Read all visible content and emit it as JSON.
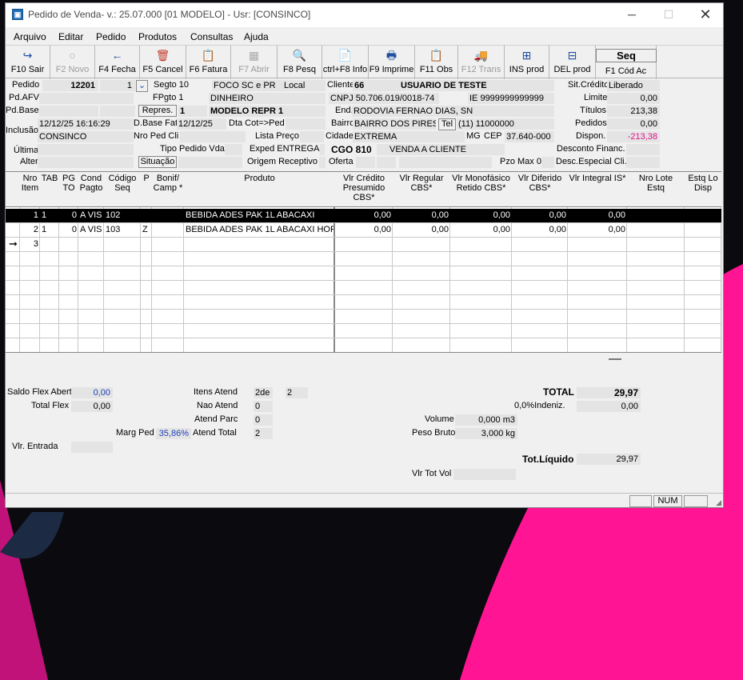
{
  "window": {
    "title": "Pedido de Venda- v.: 25.07.000  [01 MODELO] - Usr: [CONSINCO]"
  },
  "menu": [
    "Arquivo",
    "Editar",
    "Pedido",
    "Produtos",
    "Consultas",
    "Ajuda"
  ],
  "toolbar": [
    {
      "label": "F10 Sair",
      "icon": "exit-icon",
      "glyph": "↪",
      "enabled": true
    },
    {
      "label": "F2 Novo",
      "icon": "lightbulb-icon",
      "glyph": "○",
      "enabled": false
    },
    {
      "label": "F4 Fecha",
      "icon": "arrow-left-icon",
      "glyph": "←",
      "enabled": true
    },
    {
      "label": "F5 Cancel",
      "icon": "trash-icon",
      "glyph": "🗑",
      "enabled": true
    },
    {
      "label": "F6 Fatura",
      "icon": "clipboard-icon",
      "glyph": "📋",
      "enabled": true
    },
    {
      "label": "F7 Abrir",
      "icon": "table-icon",
      "glyph": "▦",
      "enabled": false
    },
    {
      "label": "F8 Pesq",
      "icon": "search-icon",
      "glyph": "🔍",
      "enabled": true
    },
    {
      "label": "ctrl+F8 Info",
      "icon": "document-icon",
      "glyph": "📄",
      "enabled": true
    },
    {
      "label": "F9 Imprime",
      "icon": "printer-icon",
      "glyph": "🖶",
      "enabled": true
    },
    {
      "label": "F11 Obs",
      "icon": "notes-icon",
      "glyph": "📋",
      "enabled": true
    },
    {
      "label": "F12 Trans",
      "icon": "truck-icon",
      "glyph": "🚚",
      "enabled": false
    },
    {
      "label": "INS prod",
      "icon": "add-row-icon",
      "glyph": "⊞",
      "enabled": true
    },
    {
      "label": "DEL prod",
      "icon": "remove-row-icon",
      "glyph": "⊟",
      "enabled": true
    },
    {
      "label": "F1 Cód Ac",
      "icon": "",
      "glyph": "",
      "enabled": true
    }
  ],
  "seq_label": "Seq",
  "header": {
    "pedido_label": "Pedido",
    "pedido": "12201",
    "pedido_seq": "1",
    "segto_label": "Segto 10",
    "segto": "FOCO SC e PR",
    "local_label": "Local",
    "cliente_label": "Cliente",
    "cliente_code": "66",
    "cliente_nome": "USUARIO DE  TESTE",
    "sit_credito_label": "Sit.Crédito",
    "sit_credito": "Liberado",
    "pdafv_label": "Pd.AFV",
    "fpgto_label": "FPgto 1",
    "fpgto": "DINHEIRO",
    "cnpj": "CNPJ 50.706.019/0018-74",
    "ie": "IE 9999999999999",
    "limite_label": "Limite",
    "limite": "0,00",
    "pdbase_label": "Pd.Base",
    "repres_btn": "Repres.",
    "repres_code": "1",
    "repres_nome": "MODELO REPR 1",
    "end_label": "End.",
    "endereco": "RODOVIA FERNAO DIAS, SN",
    "titulos_label": "Títulos",
    "titulos": "213,38",
    "inclusao_label": "Inclusão",
    "inclusao_data": "12/12/25 16:16:29",
    "inclusao_user": "CONSINCO",
    "dbase_label": "D.Base Fat",
    "dbase": "12/12/25",
    "dtacot_label": "Dta Cot=>Ped",
    "bairro_label": "Bairro",
    "bairro": "BAIRRO DOS PIRES",
    "tel_btn": "Tel",
    "telefone": "(11) 11000000",
    "pedidos_label": "Pedidos",
    "pedidos": "0,00",
    "nropedcli_label": "Nro Ped Cli",
    "lista_label": "Lista Preço",
    "cidade_label": "Cidade",
    "cidade": "EXTREMA",
    "uf": "MG",
    "cep_label": "CEP",
    "cep": "37.640-000",
    "dispon_label": "Dispon.",
    "dispon": "-213,38",
    "ultima_label": "Última",
    "alter_label": "Alter",
    "tipo_label": "Tipo Pedido Vda",
    "exped_label": "Exped ENTREGA",
    "cgo_label": "CGO 810",
    "cgo_nome": "VENDA A CLIENTE",
    "desconto_label": "Desconto Financ.",
    "situacao_btn": "Situação",
    "origem_label": "Origem Receptivo",
    "oferta_label": "Oferta",
    "pzo_label": "Pzo Max 0",
    "desc_especial_label": "Desc.Especial Cli."
  },
  "grid": {
    "columns": [
      "Nro\nItem",
      "TAB",
      "PG\nTO",
      "Cond\nPagto",
      "Código\nSeq",
      "P",
      "Bonif/\nCamp *",
      "Produto",
      "Vlr Crédito\nPresumido\nCBS*",
      "Vlr Regular\nCBS*",
      "Vlr Monofásico\nRetido CBS*",
      "Vlr Diferido\nCBS*",
      "Vlr Integral IS*",
      "Nro Lote\nEstq",
      "Estq Lo\nDisp"
    ],
    "rows": [
      {
        "item": "1",
        "tab": "1",
        "pg": "0",
        "cond": "A VIS",
        "cod": "102",
        "p": "",
        "bonif": "",
        "produto": "BEBIDA ADES PAK 1L ABACAXI",
        "v1": "0,00",
        "v2": "0,00",
        "v3": "0,00",
        "v4": "0,00",
        "v5": "0,00"
      },
      {
        "item": "2",
        "tab": "1",
        "pg": "0",
        "cond": "A VIS",
        "cod": "103",
        "p": "Z",
        "bonif": "",
        "produto": "BEBIDA ADES PAK 1L ABACAXI HOR",
        "v1": "0,00",
        "v2": "0,00",
        "v3": "0,00",
        "v4": "0,00",
        "v5": "0,00"
      },
      {
        "item": "3",
        "tab": "",
        "pg": "",
        "cond": "",
        "cod": "",
        "p": "",
        "bonif": "",
        "produto": "",
        "v1": "",
        "v2": "",
        "v3": "",
        "v4": "",
        "v5": ""
      }
    ]
  },
  "summary": {
    "saldo_flex_label": "Saldo Flex Abert",
    "saldo_flex": "0,00",
    "total_flex_label": "Total Flex",
    "total_flex": "0,00",
    "marg_ped_label": "Marg Ped",
    "marg_ped": "35,86%",
    "vlr_entrada_label": "Vlr. Entrada",
    "itens_atend_label": "Itens Atend",
    "itens_atend": "2de",
    "itens_total": "2",
    "nao_atend_label": "Nao Atend",
    "nao_atend": "0",
    "atend_parc_label": "Atend Parc",
    "atend_parc": "0",
    "atend_total_label": "Atend Total",
    "atend_total": "2",
    "volume_label": "Volume",
    "volume": "0,000 m3",
    "peso_label": "Peso Bruto",
    "peso": "3,000 kg",
    "vlr_tot_vol_label": "Vlr Tot Vol",
    "total_label": "TOTAL",
    "total": "29,97",
    "indeniz_label": "0,0%Indeniz.",
    "indeniz": "0,00",
    "tot_liquido_label": "Tot.Líquido",
    "tot_liquido": "29,97"
  },
  "status": {
    "num": "NUM"
  }
}
